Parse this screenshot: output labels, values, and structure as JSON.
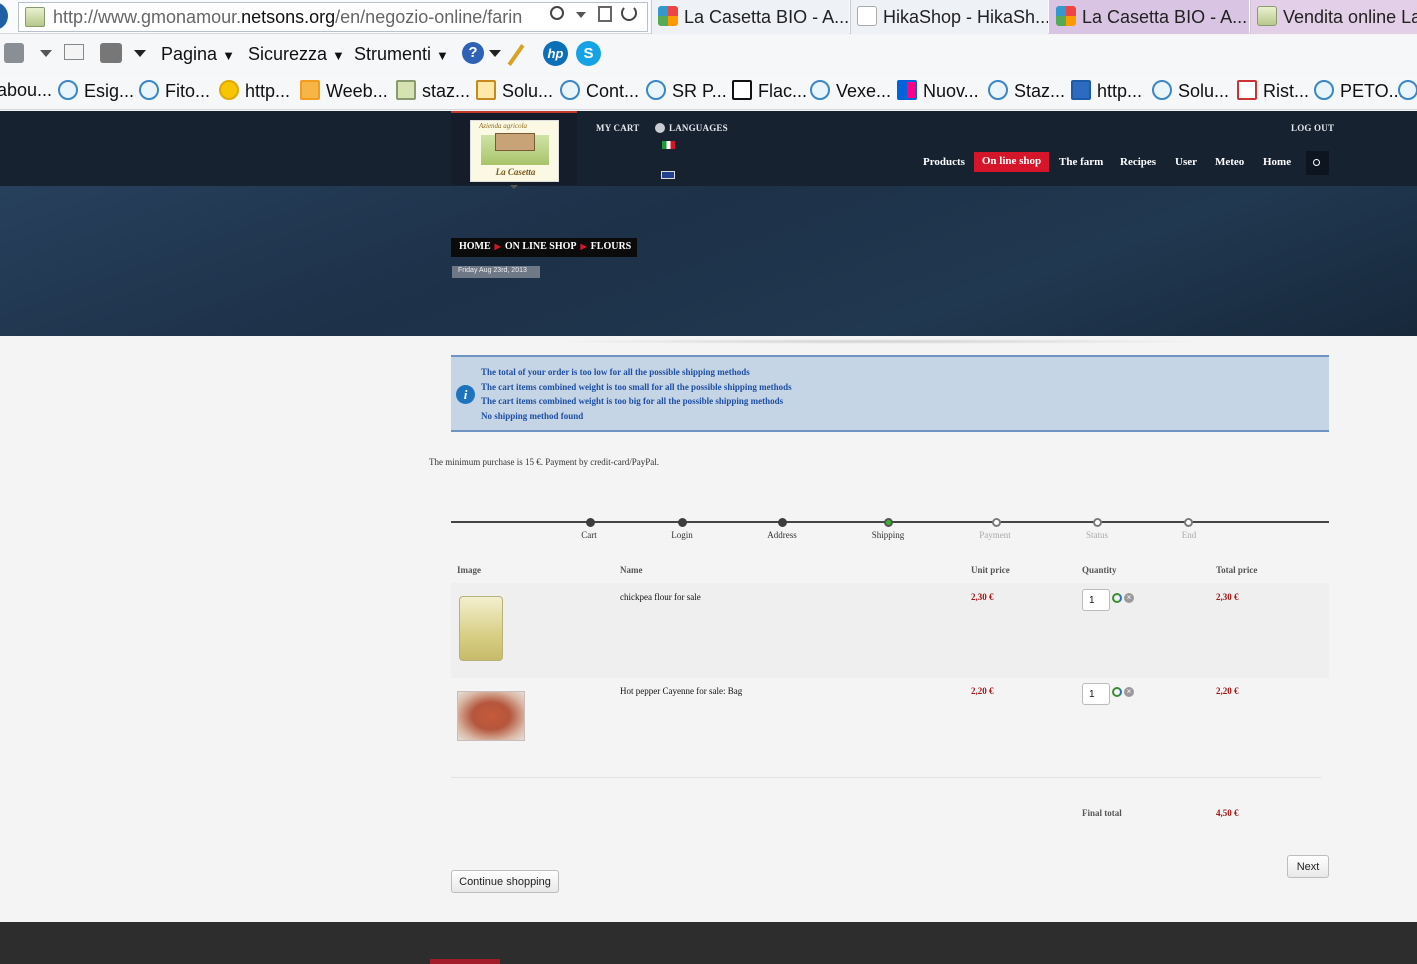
{
  "browser": {
    "url_prefix": "http://www.gmonamour.",
    "url_domain": "netsons.org",
    "url_path": "/en/negozio-online/farin",
    "tabs": [
      {
        "label": "La Casetta BIO - A..."
      },
      {
        "label": "HikaShop - HikaSh..."
      },
      {
        "label": "La Casetta BIO - A..."
      },
      {
        "label": "Vendita online La"
      }
    ],
    "commands": [
      "Pagina",
      "Sicurezza",
      "Strumenti"
    ],
    "favorites": [
      "abou...",
      "Esig...",
      "Fito...",
      "http...",
      "Weeb...",
      "staz...",
      "Solu...",
      "Cont...",
      "SR P...",
      "Flac...",
      "Vexe...",
      "Nuov...",
      "Staz...",
      "http...",
      "Solu...",
      "Rist...",
      "PETO..."
    ]
  },
  "site": {
    "logo_text_top": "Azienda agricola",
    "logo_text_bottom": "La Casetta",
    "my_cart": "MY CART",
    "languages": "LANGUAGES",
    "log_out": "LOG OUT",
    "nav": {
      "products": "Products",
      "online_shop": "On line shop",
      "the_farm": "The farm",
      "recipes": "Recipes",
      "user": "User",
      "meteo": "Meteo",
      "home": "Home"
    },
    "breadcrumb": [
      "HOME",
      "ON LINE SHOP",
      "FLOURS"
    ],
    "date": "Friday Aug 23rd, 2013"
  },
  "notice": {
    "lines": [
      "The total of your order is too low for all the possible shipping methods",
      "The cart items combined weight is too small for all the possible shipping methods",
      "The cart items combined weight is too big for all the possible shipping methods",
      "No shipping method found"
    ]
  },
  "min_purchase": "The minimum purchase is 15 €. Payment by credit-card/PayPal.",
  "steps": [
    {
      "label": "Cart",
      "state": "done"
    },
    {
      "label": "Login",
      "state": "done"
    },
    {
      "label": "Address",
      "state": "done"
    },
    {
      "label": "Shipping",
      "state": "current"
    },
    {
      "label": "Payment",
      "state": "todo"
    },
    {
      "label": "Status",
      "state": "todo"
    },
    {
      "label": "End",
      "state": "todo"
    }
  ],
  "table": {
    "headers": {
      "image": "Image",
      "name": "Name",
      "unit_price": "Unit price",
      "quantity": "Quantity",
      "total_price": "Total price"
    },
    "rows": [
      {
        "name": "chickpea flour for sale",
        "unit_price": "2,30 €",
        "quantity": "1",
        "total": "2,30 €"
      },
      {
        "name": "Hot pepper Cayenne for sale: Bag",
        "unit_price": "2,20 €",
        "quantity": "1",
        "total": "2,20 €"
      }
    ],
    "final_total_label": "Final total",
    "final_total": "4,50 €"
  },
  "buttons": {
    "continue": "Continue shopping",
    "next": "Next"
  },
  "colors": {
    "header_bg": "#172231",
    "accent_red": "#d5152a",
    "price_red": "#a31313",
    "notice_bg": "#c6d5e6",
    "notice_text": "#1d4fa3",
    "step_current": "#38b52f"
  }
}
